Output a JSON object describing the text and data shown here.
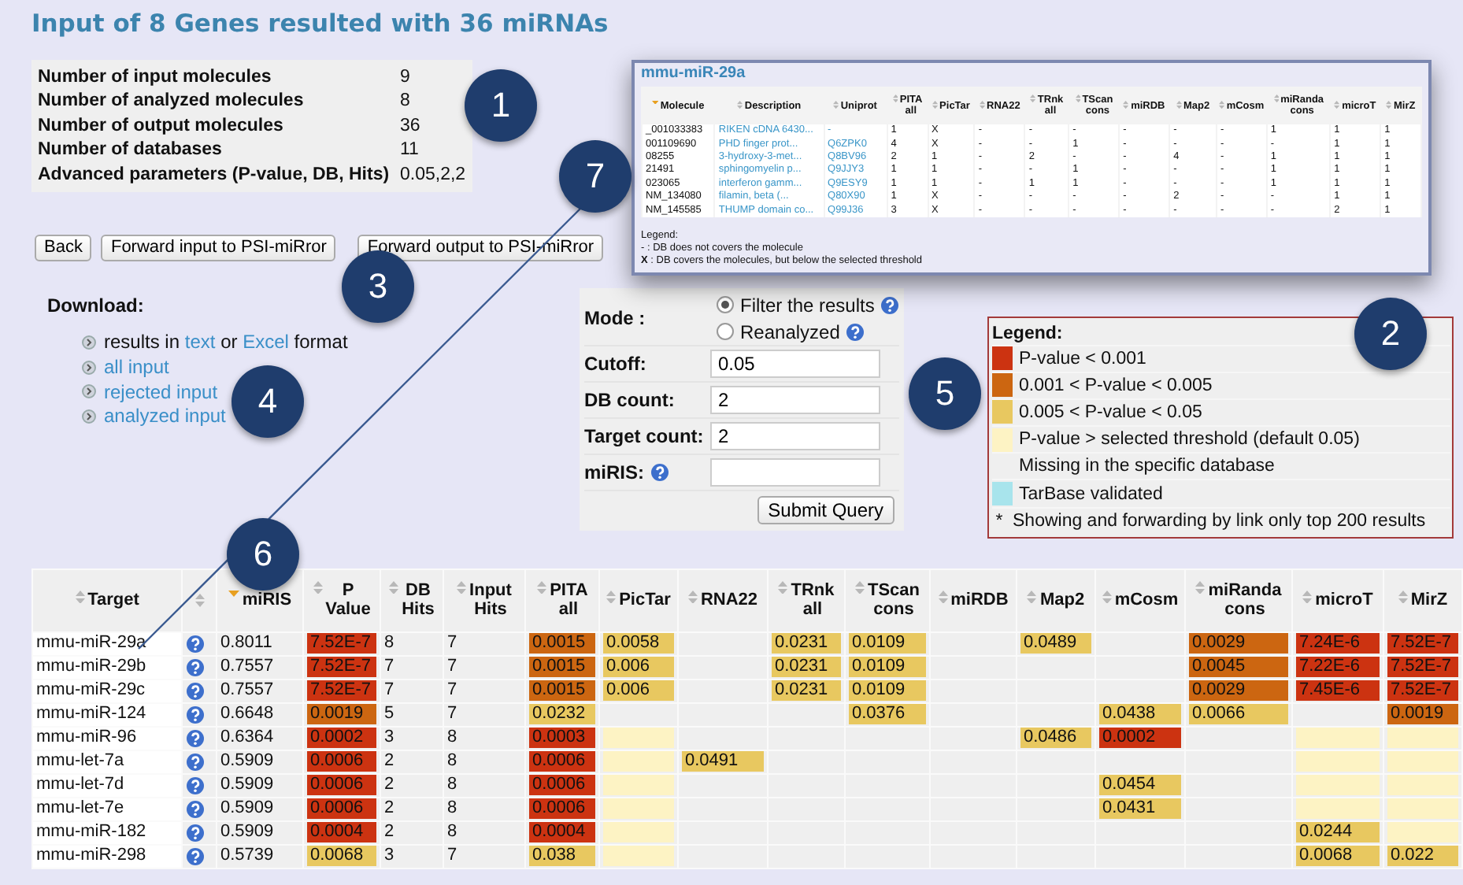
{
  "title": "Input of 8 Genes resulted with 36 miRNAs",
  "summary": [
    {
      "label": "Number of input molecules",
      "value": "9"
    },
    {
      "label": "Number of analyzed molecules",
      "value": "8"
    },
    {
      "label": "Number of output molecules",
      "value": "36"
    },
    {
      "label": "Number of databases",
      "value": "11"
    },
    {
      "label": "Advanced parameters (P-value, DB, Hits)",
      "value": "0.05,2,2"
    }
  ],
  "buttons": [
    "Back",
    "Forward input to PSI-miRror",
    "Forward output to PSI-miRror"
  ],
  "popup": {
    "title": "mmu-miR-29a",
    "columns": [
      {
        "label": "Molecule",
        "sorted": true,
        "kind": "text"
      },
      {
        "label": "Description",
        "sorted": false,
        "kind": "link"
      },
      {
        "label": "Uniprot",
        "sorted": false,
        "kind": "link"
      },
      {
        "label": "PITA all",
        "sorted": false,
        "kind": "text"
      },
      {
        "label": "PicTar",
        "sorted": false,
        "kind": "text"
      },
      {
        "label": "RNA22",
        "sorted": false,
        "kind": "text"
      },
      {
        "label": "TRnk all",
        "sorted": false,
        "kind": "text"
      },
      {
        "label": "TScan cons",
        "sorted": false,
        "kind": "text"
      },
      {
        "label": "miRDB",
        "sorted": false,
        "kind": "text"
      },
      {
        "label": "Map2",
        "sorted": false,
        "kind": "text"
      },
      {
        "label": "mCosm",
        "sorted": false,
        "kind": "text"
      },
      {
        "label": "miRanda cons",
        "sorted": false,
        "kind": "text"
      },
      {
        "label": "microT",
        "sorted": false,
        "kind": "text"
      },
      {
        "label": "MirZ",
        "sorted": false,
        "kind": "text"
      }
    ],
    "rows": [
      [
        "_001033383",
        "RIKEN cDNA 6430...",
        "-",
        "1",
        "X",
        "-",
        "-",
        "-",
        "-",
        "-",
        "-",
        "1",
        "1",
        "1"
      ],
      [
        "001109690",
        "PHD finger prot...",
        "Q6ZPK0",
        "4",
        "X",
        "-",
        "-",
        "1",
        "-",
        "-",
        "-",
        "-",
        "1",
        "1"
      ],
      [
        "08255",
        "3-hydroxy-3-met...",
        "Q8BV96",
        "2",
        "1",
        "-",
        "2",
        "-",
        "-",
        "4",
        "-",
        "1",
        "1",
        "1"
      ],
      [
        "21491",
        "sphingomyelin p...",
        "Q9JJY3",
        "1",
        "1",
        "-",
        "-",
        "1",
        "-",
        "-",
        "-",
        "1",
        "1",
        "1"
      ],
      [
        "023065",
        "interferon gamm...",
        "Q9ESY9",
        "1",
        "1",
        "-",
        "1",
        "1",
        "-",
        "-",
        "-",
        "1",
        "1",
        "1"
      ],
      [
        "NM_134080",
        "filamin, beta (...",
        "Q80X90",
        "1",
        "X",
        "-",
        "-",
        "-",
        "-",
        "2",
        "-",
        "-",
        "1",
        "1"
      ],
      [
        "NM_145585",
        "THUMP domain co...",
        "Q99J36",
        "3",
        "X",
        "-",
        "-",
        "-",
        "-",
        "-",
        "-",
        "-",
        "2",
        "1"
      ]
    ],
    "legend": [
      "Legend:",
      "- : DB does not covers the molecule",
      "**X** : DB covers the molecules, but below the selected threshold"
    ]
  },
  "download": {
    "heading": "Download:",
    "items": [
      {
        "segments": [
          {
            "text": "results in",
            "link": false
          },
          {
            "text": "text",
            "link": true
          },
          {
            "text": "or",
            "link": false
          },
          {
            "text": "Excel",
            "link": true
          },
          {
            "text": "format",
            "link": false
          }
        ]
      },
      {
        "segments": [
          {
            "text": "all input",
            "link": true
          }
        ]
      },
      {
        "segments": [
          {
            "text": "rejected input",
            "link": true
          }
        ]
      },
      {
        "segments": [
          {
            "text": "analyzed input",
            "link": true
          }
        ]
      }
    ]
  },
  "form": {
    "mode_label": "Mode :",
    "options": [
      {
        "label": "Filter the results",
        "selected": true,
        "help": true
      },
      {
        "label": "Reanalyzed",
        "selected": false,
        "help": true
      }
    ],
    "fields": [
      {
        "label": "Cutoff:",
        "value": "0.05",
        "help": false
      },
      {
        "label": "DB count:",
        "value": "2",
        "help": false
      },
      {
        "label": "Target count:",
        "value": "2",
        "help": false
      },
      {
        "label": "miRIS:",
        "help": true
      }
    ],
    "submit": "Submit Query"
  },
  "legend": {
    "title": "Legend:",
    "items": [
      {
        "kind": "swatch",
        "text": "P-value < 0.001",
        "color": "#cc3311"
      },
      {
        "kind": "swatch",
        "text": "0.001 < P-value < 0.005",
        "color": "#cc6611"
      },
      {
        "kind": "swatch",
        "text": "0.005 < P-value < 0.05",
        "color": "#e8c860"
      },
      {
        "kind": "swatch",
        "text": "P-value > selected threshold (default 0.05)",
        "color": "#fdf3c4"
      },
      {
        "kind": "plain",
        "text": "Missing in the specific database"
      },
      {
        "kind": "swatch",
        "text": "TarBase validated",
        "color": "#a8e4ec"
      },
      {
        "kind": "note",
        "marker": "*",
        "text": "Showing and forwarding by link only top 200 results"
      }
    ]
  },
  "results": {
    "columns": [
      {
        "label": "Target",
        "sorted": false
      },
      {
        "sorted": false
      },
      {
        "label": "miRIS",
        "sorted": true
      },
      {
        "label": "P Value",
        "sorted": false
      },
      {
        "label": "DB Hits",
        "sorted": false
      },
      {
        "label": "Input Hits",
        "sorted": false
      },
      {
        "label": "PITA all",
        "sorted": false
      },
      {
        "label": "PicTar",
        "sorted": false
      },
      {
        "label": "RNA22",
        "sorted": false
      },
      {
        "label": "TRnk all",
        "sorted": false
      },
      {
        "label": "TScan cons",
        "sorted": false
      },
      {
        "label": "miRDB",
        "sorted": false
      },
      {
        "label": "Map2",
        "sorted": false
      },
      {
        "label": "mCosm",
        "sorted": false
      },
      {
        "label": "miRanda cons",
        "sorted": false
      },
      {
        "label": "microT",
        "sorted": false
      },
      {
        "label": "MirZ",
        "sorted": false
      }
    ],
    "rows": [
      {
        "target": "mmu-miR-29a",
        "miris": "0.8011",
        "p_value": {
          "text": "7.52E-7",
          "color": "#cc3311"
        },
        "db_hits": "8",
        "input_hits": "7",
        "scores": {
          "pita": {
            "text": "0.0015",
            "color": "#cc6611"
          },
          "pictar": {
            "text": "0.0058",
            "color": "#e8c860"
          },
          "trnk": {
            "text": "0.0231",
            "color": "#e8c860"
          },
          "tscan": {
            "text": "0.0109",
            "color": "#e8c860"
          },
          "map2": {
            "text": "0.0489",
            "color": "#e8c860"
          },
          "miranda": {
            "text": "0.0029",
            "color": "#cc6611"
          },
          "microt": {
            "text": "7.24E-6",
            "color": "#cc3311"
          },
          "mirz": {
            "text": "7.52E-7",
            "color": "#cc3311"
          }
        }
      },
      {
        "target": "mmu-miR-29b",
        "miris": "0.7557",
        "p_value": {
          "text": "7.52E-7",
          "color": "#cc3311"
        },
        "db_hits": "7",
        "input_hits": "7",
        "scores": {
          "pita": {
            "text": "0.0015",
            "color": "#cc6611"
          },
          "pictar": {
            "text": "0.006",
            "color": "#e8c860"
          },
          "trnk": {
            "text": "0.0231",
            "color": "#e8c860"
          },
          "tscan": {
            "text": "0.0109",
            "color": "#e8c860"
          },
          "miranda": {
            "text": "0.0045",
            "color": "#cc6611"
          },
          "microt": {
            "text": "7.22E-6",
            "color": "#cc3311"
          },
          "mirz": {
            "text": "7.52E-7",
            "color": "#cc3311"
          }
        }
      },
      {
        "target": "mmu-miR-29c",
        "miris": "0.7557",
        "p_value": {
          "text": "7.52E-7",
          "color": "#cc3311"
        },
        "db_hits": "7",
        "input_hits": "7",
        "scores": {
          "pita": {
            "text": "0.0015",
            "color": "#cc6611"
          },
          "pictar": {
            "text": "0.006",
            "color": "#e8c860"
          },
          "trnk": {
            "text": "0.0231",
            "color": "#e8c860"
          },
          "tscan": {
            "text": "0.0109",
            "color": "#e8c860"
          },
          "miranda": {
            "text": "0.0029",
            "color": "#cc6611"
          },
          "microt": {
            "text": "7.45E-6",
            "color": "#cc3311"
          },
          "mirz": {
            "text": "7.52E-7",
            "color": "#cc3311"
          }
        }
      },
      {
        "target": "mmu-miR-124",
        "miris": "0.6648",
        "p_value": {
          "text": "0.0019",
          "color": "#cc6611"
        },
        "db_hits": "5",
        "input_hits": "7",
        "scores": {
          "pita": {
            "text": "0.0232",
            "color": "#e8c860"
          },
          "tscan": {
            "text": "0.0376",
            "color": "#e8c860"
          },
          "mcosm": {
            "text": "0.0438",
            "color": "#e8c860"
          },
          "miranda": {
            "text": "0.0066",
            "color": "#e8c860"
          },
          "mirz": {
            "text": "0.0019",
            "color": "#cc6611"
          }
        }
      },
      {
        "target": "mmu-miR-96",
        "miris": "0.6364",
        "p_value": {
          "text": "0.0002",
          "color": "#cc3311"
        },
        "db_hits": "3",
        "input_hits": "8",
        "scores": {
          "pita": {
            "text": "0.0003",
            "color": "#cc3311"
          },
          "pictar": {
            "color": "#fdf3c4"
          },
          "map2": {
            "text": "0.0486",
            "color": "#e8c860"
          },
          "mcosm": {
            "text": "0.0002",
            "color": "#cc3311"
          },
          "microt": {
            "color": "#fdf3c4"
          },
          "mirz": {
            "color": "#fdf3c4"
          }
        }
      },
      {
        "target": "mmu-let-7a",
        "miris": "0.5909",
        "p_value": {
          "text": "0.0006",
          "color": "#cc3311"
        },
        "db_hits": "2",
        "input_hits": "8",
        "scores": {
          "pita": {
            "text": "0.0006",
            "color": "#cc3311"
          },
          "pictar": {
            "color": "#fdf3c4"
          },
          "rna22": {
            "text": "0.0491",
            "color": "#e8c860"
          },
          "microt": {
            "color": "#fdf3c4"
          },
          "mirz": {
            "color": "#fdf3c4"
          }
        }
      },
      {
        "target": "mmu-let-7d",
        "miris": "0.5909",
        "p_value": {
          "text": "0.0006",
          "color": "#cc3311"
        },
        "db_hits": "2",
        "input_hits": "8",
        "scores": {
          "pita": {
            "text": "0.0006",
            "color": "#cc3311"
          },
          "pictar": {
            "color": "#fdf3c4"
          },
          "mcosm": {
            "text": "0.0454",
            "color": "#e8c860"
          },
          "microt": {
            "color": "#fdf3c4"
          },
          "mirz": {
            "color": "#fdf3c4"
          }
        }
      },
      {
        "target": "mmu-let-7e",
        "miris": "0.5909",
        "p_value": {
          "text": "0.0006",
          "color": "#cc3311"
        },
        "db_hits": "2",
        "input_hits": "8",
        "scores": {
          "pita": {
            "text": "0.0006",
            "color": "#cc3311"
          },
          "pictar": {
            "color": "#fdf3c4"
          },
          "mcosm": {
            "text": "0.0431",
            "color": "#e8c860"
          },
          "microt": {
            "color": "#fdf3c4"
          },
          "mirz": {
            "color": "#fdf3c4"
          }
        }
      },
      {
        "target": "mmu-miR-182",
        "miris": "0.5909",
        "p_value": {
          "text": "0.0004",
          "color": "#cc3311"
        },
        "db_hits": "2",
        "input_hits": "8",
        "scores": {
          "pita": {
            "text": "0.0004",
            "color": "#cc3311"
          },
          "pictar": {
            "color": "#fdf3c4"
          },
          "microt": {
            "text": "0.0244",
            "color": "#e8c860"
          },
          "mirz": {
            "color": "#fdf3c4"
          }
        }
      },
      {
        "target": "mmu-miR-298",
        "miris": "0.5739",
        "p_value": {
          "text": "0.0068",
          "color": "#e8c860"
        },
        "db_hits": "3",
        "input_hits": "7",
        "scores": {
          "pita": {
            "text": "0.038",
            "color": "#e8c860"
          },
          "pictar": {
            "color": "#fdf3c4"
          },
          "microt": {
            "text": "0.0068",
            "color": "#e8c860"
          },
          "mirz": {
            "text": "0.022",
            "color": "#e8c860"
          }
        }
      }
    ]
  },
  "markers": [
    {
      "number": "1"
    },
    {
      "number": "2"
    },
    {
      "number": "3"
    },
    {
      "number": "4"
    },
    {
      "number": "5"
    },
    {
      "number": "6"
    },
    {
      "number": "7"
    }
  ]
}
